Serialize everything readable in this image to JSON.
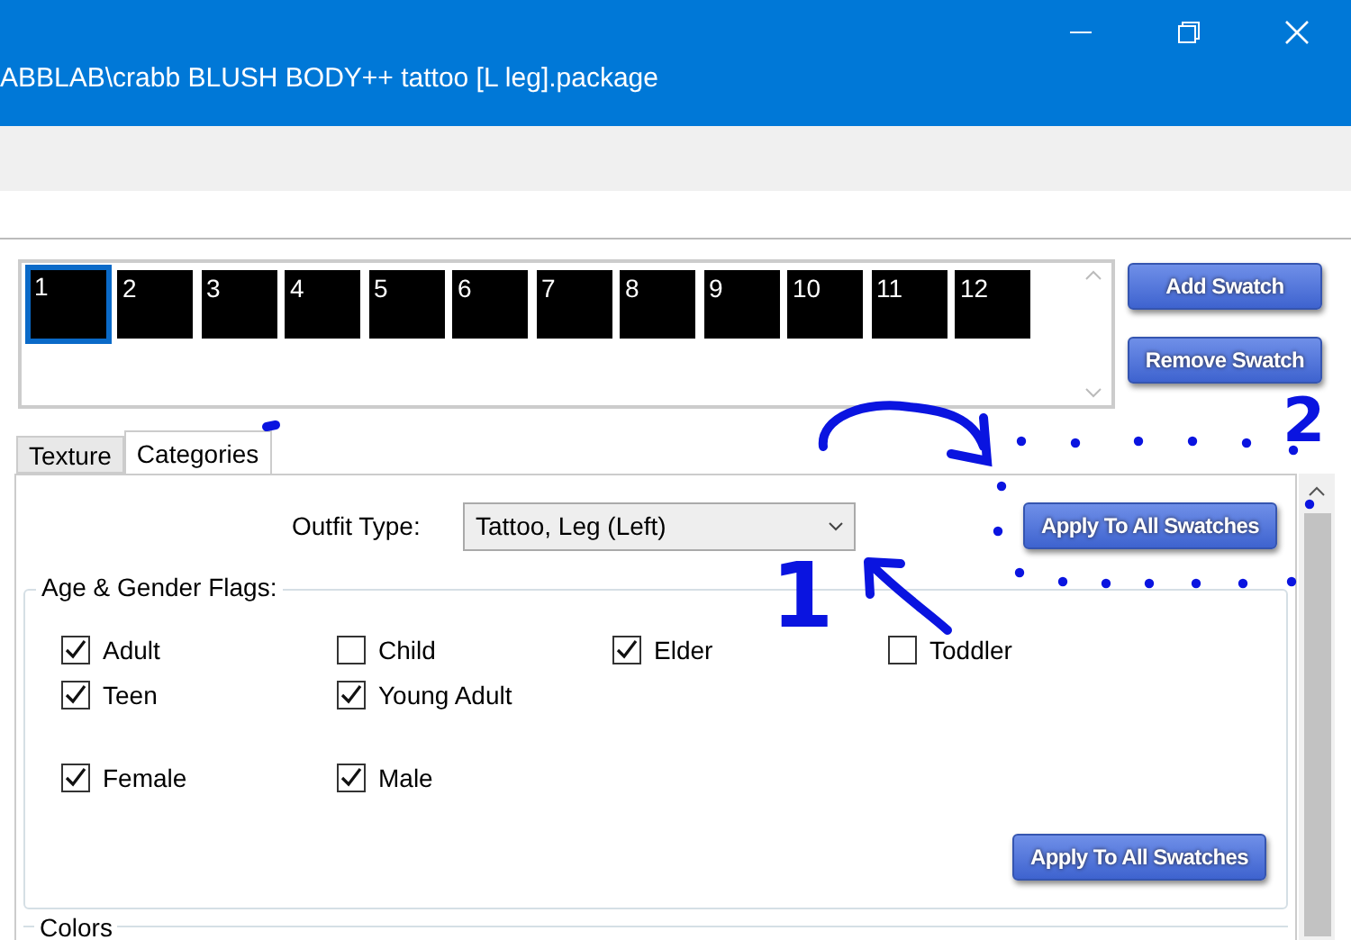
{
  "window": {
    "title": "ABBLAB\\crabb BLUSH BODY++ tattoo [L leg].package"
  },
  "swatches": [
    {
      "label": "1",
      "selected": true
    },
    {
      "label": "2",
      "selected": false
    },
    {
      "label": "3",
      "selected": false
    },
    {
      "label": "4",
      "selected": false
    },
    {
      "label": "5",
      "selected": false
    },
    {
      "label": "6",
      "selected": false
    },
    {
      "label": "7",
      "selected": false
    },
    {
      "label": "8",
      "selected": false
    },
    {
      "label": "9",
      "selected": false
    },
    {
      "label": "10",
      "selected": false
    },
    {
      "label": "11",
      "selected": false
    },
    {
      "label": "12",
      "selected": false
    }
  ],
  "swatch_buttons": [
    "Add Swatch",
    "Remove Swatch"
  ],
  "tabs": [
    {
      "label": "Texture",
      "selected": false
    },
    {
      "label": "Categories",
      "selected": true
    }
  ],
  "outfit_type": {
    "label": "Outfit Type:",
    "value": "Tattoo, Leg (Left)"
  },
  "apply_button": "Apply To All Swatches",
  "flags": {
    "title": "Age & Gender Flags:",
    "rows": [
      [
        {
          "label": "Adult",
          "checked": true
        },
        {
          "label": "Child",
          "checked": false
        },
        {
          "label": "Elder",
          "checked": true
        },
        {
          "label": "Toddler",
          "checked": false
        }
      ],
      [
        {
          "label": "Teen",
          "checked": true
        },
        {
          "label": "Young Adult",
          "checked": true
        }
      ],
      [
        {
          "label": "Female",
          "checked": true
        },
        {
          "label": "Male",
          "checked": true
        }
      ]
    ],
    "apply_button": "Apply To All Swatches"
  },
  "colors": {
    "title": "Colors"
  },
  "annotations": [
    {
      "label": "1"
    },
    {
      "label": "2"
    }
  ]
}
